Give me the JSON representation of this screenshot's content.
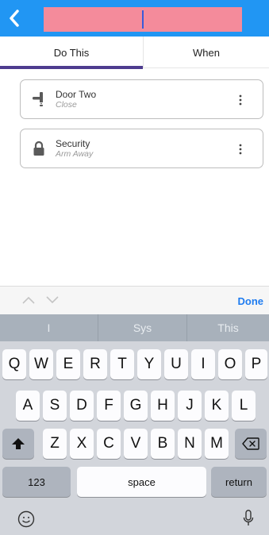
{
  "header": {
    "back_icon": "chevron-left-icon",
    "title_value": ""
  },
  "tabs": [
    {
      "label": "Do This",
      "selected": true
    },
    {
      "label": "When",
      "selected": false
    }
  ],
  "actions": [
    {
      "name": "Door Two",
      "state": "Close",
      "icon": "door-handle-icon"
    },
    {
      "name": "Security",
      "state": "Arm Away",
      "icon": "lock-icon"
    }
  ],
  "keyboard_toolbar": {
    "prev_icon": "chevron-up-icon",
    "next_icon": "chevron-down-icon",
    "done_label": "Done"
  },
  "suggestions": [
    "I",
    "Sys",
    "This"
  ],
  "keys": {
    "row1": [
      "Q",
      "W",
      "E",
      "R",
      "T",
      "Y",
      "U",
      "I",
      "O",
      "P"
    ],
    "row2": [
      "A",
      "S",
      "D",
      "F",
      "G",
      "H",
      "J",
      "K",
      "L"
    ],
    "row3": [
      "Z",
      "X",
      "C",
      "V",
      "B",
      "N",
      "M"
    ],
    "numbers_label": "123",
    "space_label": "space",
    "return_label": "return"
  },
  "colors": {
    "header": "#2196f3",
    "title_field": "#f48b9b",
    "tab_underline": "#4e3c8f",
    "done": "#1f7cf0"
  }
}
